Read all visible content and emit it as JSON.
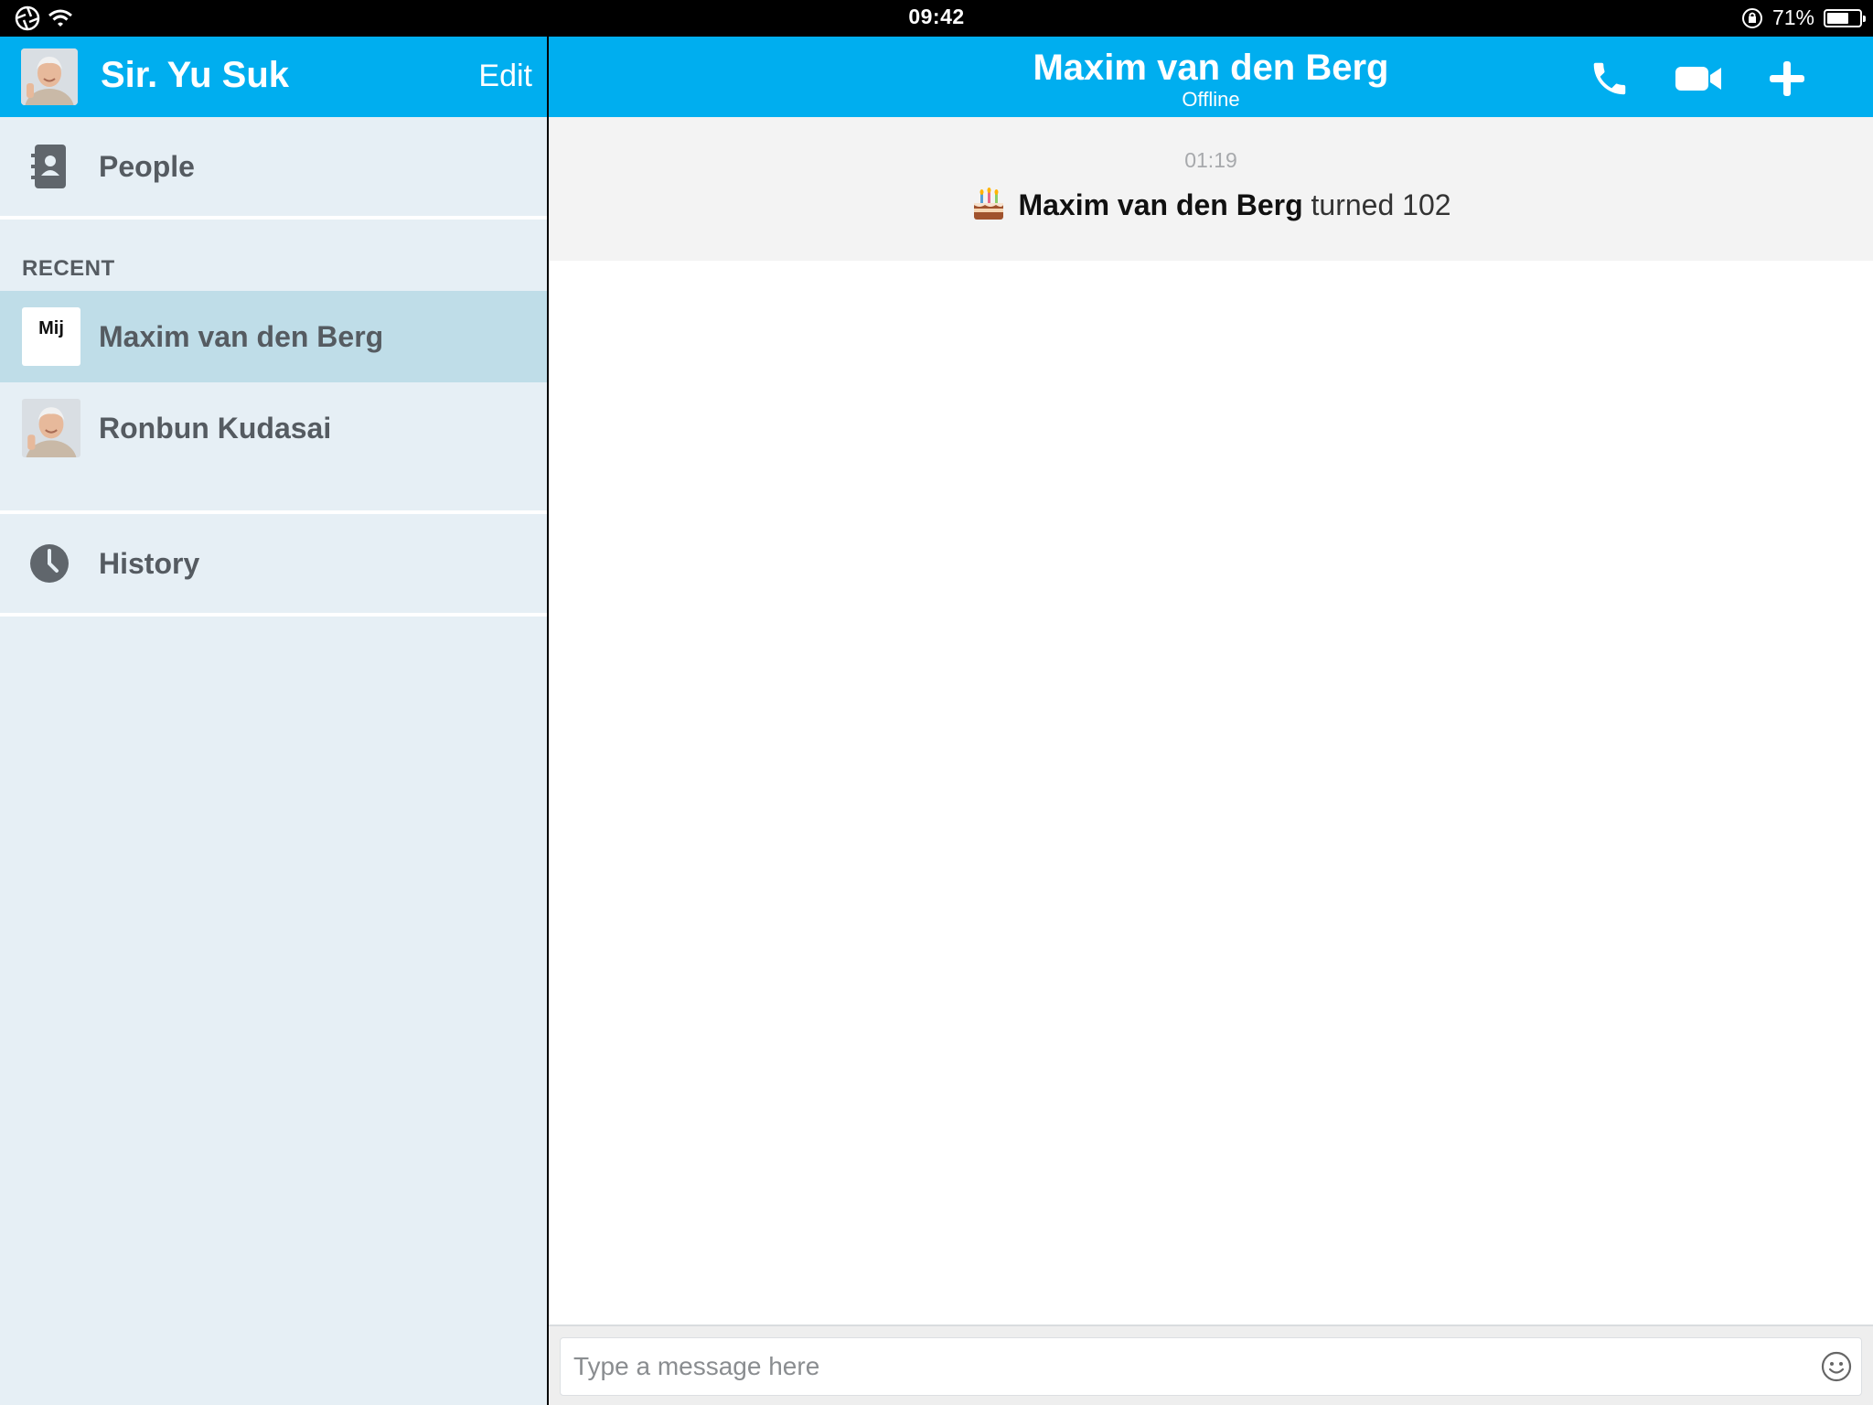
{
  "status_bar": {
    "time": "09:42",
    "battery": "71%",
    "battery_level": 0.71
  },
  "sidebar": {
    "user_name": "Sir. Yu Suk",
    "edit_label": "Edit",
    "people_label": "People",
    "recent_header": "RECENT",
    "recent": [
      {
        "name": "Maxim van den Berg",
        "thumb_text": "Mij",
        "selected": true
      },
      {
        "name": "Ronbun Kudasai",
        "thumb_text": "",
        "selected": false
      }
    ],
    "history_label": "History"
  },
  "conversation": {
    "contact_name": "Maxim van den Berg",
    "contact_status": "Offline",
    "event": {
      "time": "01:19",
      "who": "Maxim van den Berg",
      "text": "turned 102",
      "icon": "birthday-cake-icon"
    }
  },
  "composer": {
    "placeholder": "Type a message here",
    "value": ""
  },
  "colors": {
    "accent": "#00aeef",
    "sidebar_bg": "#e6eff5",
    "selected_row": "#bfdde8",
    "sidebar_text": "#555b61"
  }
}
